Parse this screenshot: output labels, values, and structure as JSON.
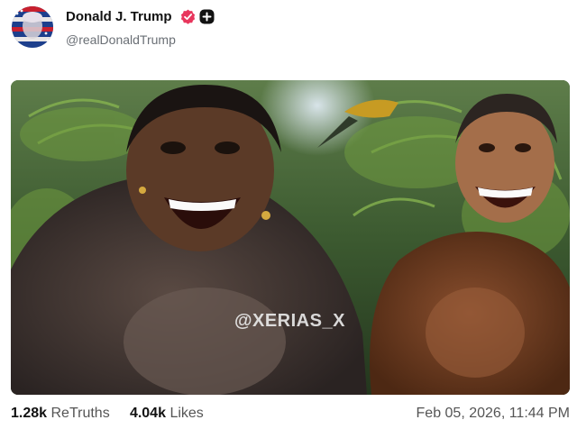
{
  "post": {
    "author_name": "Donald J. Trump",
    "author_handle": "@realDonaldTrump",
    "verified_icon": "verified-badge-icon",
    "affiliation_icon": "plus-badge-icon",
    "media": {
      "watermark": "@XERIAS_X"
    },
    "stats": {
      "retruths_count": "1.28k",
      "retruths_label": "ReTruths",
      "likes_count": "4.04k",
      "likes_label": "Likes"
    },
    "timestamp": "Feb 05, 2026, 11:44 PM"
  },
  "colors": {
    "verified": "#e8365d",
    "accent_dark": "#111111",
    "muted_text": "#6a6f75"
  }
}
